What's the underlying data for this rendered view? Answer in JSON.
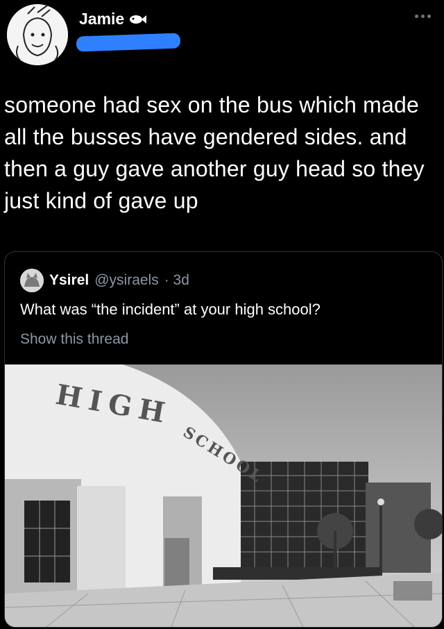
{
  "author": {
    "name": "Jamie",
    "badge_icon": "fish-icon"
  },
  "tweet": {
    "text": "someone had sex on the bus which made all the busses have gendered sides. and then a guy gave another guy head so they just kind of gave up"
  },
  "quoted": {
    "name": "Ysirel",
    "handle": "@ysiraels",
    "time": "· 3d",
    "text": "What was “the incident” at your high school?",
    "show_thread": "Show this thread"
  },
  "image": {
    "sign_line1": "HIGH",
    "sign_line2": "SCHOOL"
  },
  "colors": {
    "background": "#000000",
    "muted": "#8b98a5",
    "redaction": "#2f80ff"
  }
}
